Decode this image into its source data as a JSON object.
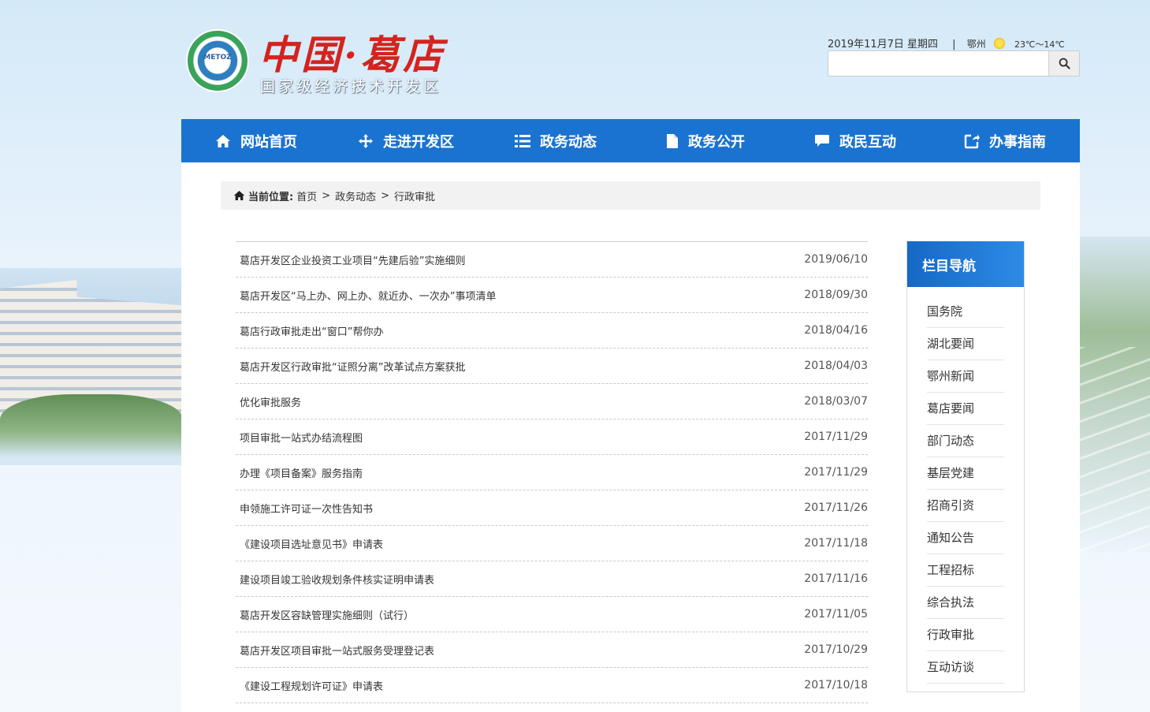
{
  "header": {
    "logo_text": "METOZ",
    "site_title": "中国·葛店",
    "site_subtitle": "国家级经济技术开发区",
    "date": "2019年11月7日 星期四",
    "separator": "|",
    "city": "鄂州",
    "temperature": "23℃～14℃",
    "search_placeholder": ""
  },
  "nav": {
    "items": [
      {
        "label": "网站首页",
        "icon": "home-icon"
      },
      {
        "label": "走进开发区",
        "icon": "move-icon"
      },
      {
        "label": "政务动态",
        "icon": "list-icon"
      },
      {
        "label": "政务公开",
        "icon": "document-icon"
      },
      {
        "label": "政民互动",
        "icon": "chat-icon"
      },
      {
        "label": "办事指南",
        "icon": "share-icon"
      }
    ]
  },
  "breadcrumb": {
    "label": "当前位置:",
    "items": [
      "首页",
      "政务动态",
      "行政审批"
    ],
    "sep": ">"
  },
  "articles": [
    {
      "title": "葛店开发区企业投资工业项目“先建后验”实施细则",
      "date": "2019/06/10"
    },
    {
      "title": "葛店开发区“马上办、网上办、就近办、一次办”事项清单",
      "date": "2018/09/30"
    },
    {
      "title": "葛店行政审批走出“窗口”帮你办",
      "date": "2018/04/16"
    },
    {
      "title": "葛店开发区行政审批“证照分离”改革试点方案获批",
      "date": "2018/04/03"
    },
    {
      "title": "优化审批服务",
      "date": "2018/03/07"
    },
    {
      "title": "项目审批一站式办结流程图",
      "date": "2017/11/29"
    },
    {
      "title": "办理《项目备案》服务指南",
      "date": "2017/11/29"
    },
    {
      "title": "申领施工许可证一次性告知书",
      "date": "2017/11/26"
    },
    {
      "title": "《建设项目选址意见书》申请表",
      "date": "2017/11/18"
    },
    {
      "title": "建设项目竣工验收规划条件核实证明申请表",
      "date": "2017/11/16"
    },
    {
      "title": "葛店开发区容缺管理实施细则（试行）",
      "date": "2017/11/05"
    },
    {
      "title": "葛店开发区项目审批一站式服务受理登记表",
      "date": "2017/10/29"
    },
    {
      "title": "《建设工程规划许可证》申请表",
      "date": "2017/10/18"
    }
  ],
  "sidebar": {
    "title": "栏目导航",
    "items": [
      "国务院",
      "湖北要闻",
      "鄂州新闻",
      "葛店要闻",
      "部门动态",
      "基层党建",
      "招商引资",
      "通知公告",
      "工程招标",
      "综合执法",
      "行政审批",
      "互动访谈"
    ]
  },
  "colors": {
    "nav_bg": "#1a73d0",
    "title_red": "#d4231e",
    "sidebar_head": "#1668c6"
  }
}
